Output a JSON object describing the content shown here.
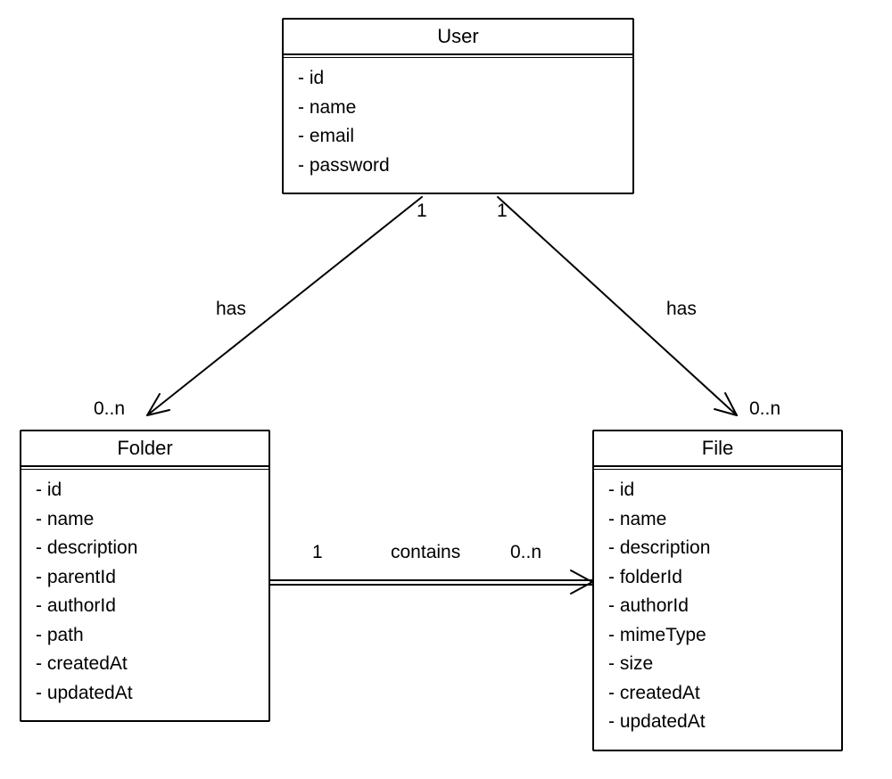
{
  "entities": {
    "user": {
      "title": "User",
      "attrs": [
        "- id",
        "- name",
        "- email",
        "- password"
      ]
    },
    "folder": {
      "title": "Folder",
      "attrs": [
        "- id",
        "- name",
        "- description",
        "- parentId",
        "- authorId",
        "- path",
        "- createdAt",
        "- updatedAt"
      ]
    },
    "file": {
      "title": "File",
      "attrs": [
        "- id",
        "- name",
        "- description",
        "- folderId",
        "- authorId",
        "- mimeType",
        "- size",
        "- createdAt",
        "- updatedAt"
      ]
    }
  },
  "relations": {
    "user_folder": {
      "label": "has",
      "mult_from": "1",
      "mult_to": "0..n"
    },
    "user_file": {
      "label": "has",
      "mult_from": "1",
      "mult_to": "0..n"
    },
    "folder_file": {
      "label": "contains",
      "mult_from": "1",
      "mult_to": "0..n"
    }
  }
}
